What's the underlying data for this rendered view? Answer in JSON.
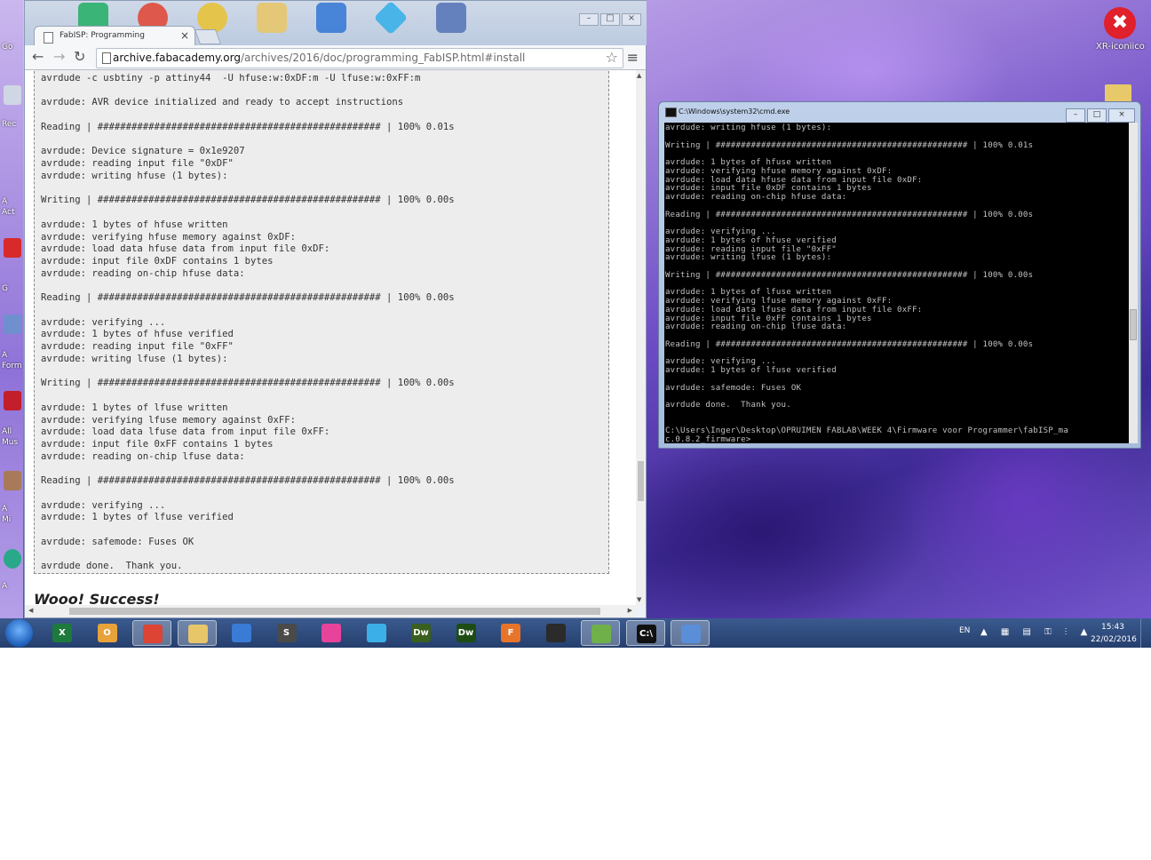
{
  "desktop": {
    "right_icon_label": "XR-iconiico",
    "right_icon_glyph": "✖",
    "left_labels": [
      "Go",
      "Rec",
      "A",
      "Act",
      "G",
      "A",
      "Form",
      "All",
      "Mus",
      "A",
      "Mi",
      "A"
    ]
  },
  "browser": {
    "tab_title": "FabISP: Programming",
    "tab_close": "×",
    "url_domain": "archive.fabacademy.org",
    "url_path": "/archives/2016/doc/programming_FabISP.html#install",
    "back_icon": "←",
    "forward_icon": "→",
    "reload_icon": "↻",
    "star_icon": "☆",
    "menu_icon": "≡",
    "window_minimize": "–",
    "window_maximize": "□",
    "window_close": "×",
    "terminal_output": "avrdude -c usbtiny -p attiny44  -U hfuse:w:0xDF:m -U lfuse:w:0xFF:m\n\navrdude: AVR device initialized and ready to accept instructions\n\nReading | ################################################## | 100% 0.01s\n\navrdude: Device signature = 0x1e9207\navrdude: reading input file \"0xDF\"\navrdude: writing hfuse (1 bytes):\n\nWriting | ################################################## | 100% 0.00s\n\navrdude: 1 bytes of hfuse written\navrdude: verifying hfuse memory against 0xDF:\navrdude: load data hfuse data from input file 0xDF:\navrdude: input file 0xDF contains 1 bytes\navrdude: reading on-chip hfuse data:\n\nReading | ################################################## | 100% 0.00s\n\navrdude: verifying ...\navrdude: 1 bytes of hfuse verified\navrdude: reading input file \"0xFF\"\navrdude: writing lfuse (1 bytes):\n\nWriting | ################################################## | 100% 0.00s\n\navrdude: 1 bytes of lfuse written\navrdude: verifying lfuse memory against 0xFF:\navrdude: load data lfuse data from input file 0xFF:\navrdude: input file 0xFF contains 1 bytes\navrdude: reading on-chip lfuse data:\n\nReading | ################################################## | 100% 0.00s\n\navrdude: verifying ...\navrdude: 1 bytes of lfuse verified\n\navrdude: safemode: Fuses OK\n\navrdude done.  Thank you.",
    "success_heading": "Wooo! Success!"
  },
  "cmd": {
    "title": "C:\\Windows\\system32\\cmd.exe",
    "minimize": "–",
    "maximize": "□",
    "close": "×",
    "output": "avrdude: writing hfuse (1 bytes):\n\nWriting | ################################################## | 100% 0.01s\n\navrdude: 1 bytes of hfuse written\navrdude: verifying hfuse memory against 0xDF:\navrdude: load data hfuse data from input file 0xDF:\navrdude: input file 0xDF contains 1 bytes\navrdude: reading on-chip hfuse data:\n\nReading | ################################################## | 100% 0.00s\n\navrdude: verifying ...\navrdude: 1 bytes of hfuse verified\navrdude: reading input file \"0xFF\"\navrdude: writing lfuse (1 bytes):\n\nWriting | ################################################## | 100% 0.00s\n\navrdude: 1 bytes of lfuse written\navrdude: verifying lfuse memory against 0xFF:\navrdude: load data lfuse data from input file 0xFF:\navrdude: input file 0xFF contains 1 bytes\navrdude: reading on-chip lfuse data:\n\nReading | ################################################## | 100% 0.00s\n\navrdude: verifying ...\navrdude: 1 bytes of lfuse verified\n\navrdude: safemode: Fuses OK\n\navrdude done.  Thank you.\n\n\nC:\\Users\\Inger\\Desktop\\OPRUIMEN FABLAB\\WEEK 4\\Firmware voor Programmer\\fabISP_ma\nc.0.8.2_firmware>"
  },
  "taskbar": {
    "items": [
      {
        "name": "excel-icon",
        "glyph": "X",
        "color": "#1e7a3c"
      },
      {
        "name": "outlook-icon",
        "glyph": "O",
        "color": "#e8a23a"
      },
      {
        "name": "chrome-icon",
        "glyph": "",
        "color": "#dd4433"
      },
      {
        "name": "file-explorer-icon",
        "glyph": "",
        "color": "#e7c66a"
      },
      {
        "name": "inkscape-pen-icon",
        "glyph": "",
        "color": "#3a7bd5"
      },
      {
        "name": "sublime-text-icon",
        "glyph": "S",
        "color": "#4a4a4a"
      },
      {
        "name": "color-blocks-icon",
        "glyph": "",
        "color": "#e8439a"
      },
      {
        "name": "diamond-app-icon",
        "glyph": "",
        "color": "#3bb0e8"
      },
      {
        "name": "dreamweaver-icon",
        "glyph": "Dw",
        "color": "#3b5f1e"
      },
      {
        "name": "dreamweaver-2-icon",
        "glyph": "Dw",
        "color": "#1d4d14"
      },
      {
        "name": "fusion-360-icon",
        "glyph": "F",
        "color": "#e8742a"
      },
      {
        "name": "inkscape-icon",
        "glyph": "",
        "color": "#2b2b2b"
      },
      {
        "name": "notepad-chart-icon",
        "glyph": "",
        "color": "#6fb04a"
      },
      {
        "name": "cmd-taskbar-icon",
        "glyph": "C:\\",
        "color": "#111111"
      },
      {
        "name": "control-panel-icon",
        "glyph": "",
        "color": "#5a8ed8"
      }
    ],
    "language": "EN",
    "tray_icons": "▲ ▦ ▤ ⚿ ⫶ ▲",
    "time": "15:43",
    "date": "22/02/2016"
  }
}
